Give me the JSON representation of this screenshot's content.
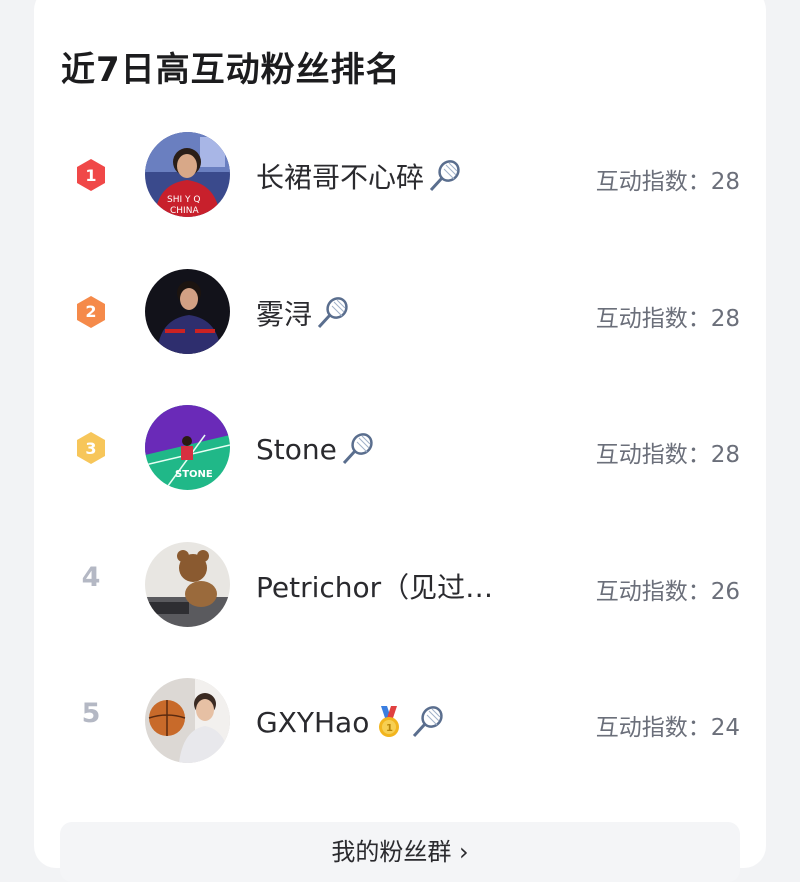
{
  "title": "近7日高互动粉丝排名",
  "score_label": "互动指数：",
  "fans": [
    {
      "rank": "1",
      "name": "长裙哥不心碎",
      "emojis": [
        "badminton-icon"
      ],
      "score": "28"
    },
    {
      "rank": "2",
      "name": "雾浔",
      "emojis": [
        "badminton-icon"
      ],
      "score": "28"
    },
    {
      "rank": "3",
      "name": "Stone",
      "emojis": [
        "badminton-icon"
      ],
      "score": "28"
    },
    {
      "rank": "4",
      "name": "Petrichor（见过…",
      "emojis": [],
      "score": "26"
    },
    {
      "rank": "5",
      "name": "GXYHao",
      "emojis": [
        "gold-medal-icon",
        "badminton-icon"
      ],
      "score": "24"
    }
  ],
  "bottom_button": "我的粉丝群 ›",
  "colors": {
    "rank1": "#f04848",
    "rank2": "#f58a4a",
    "rank3": "#f7c65a",
    "rank_plain": "#b4b8c4"
  }
}
